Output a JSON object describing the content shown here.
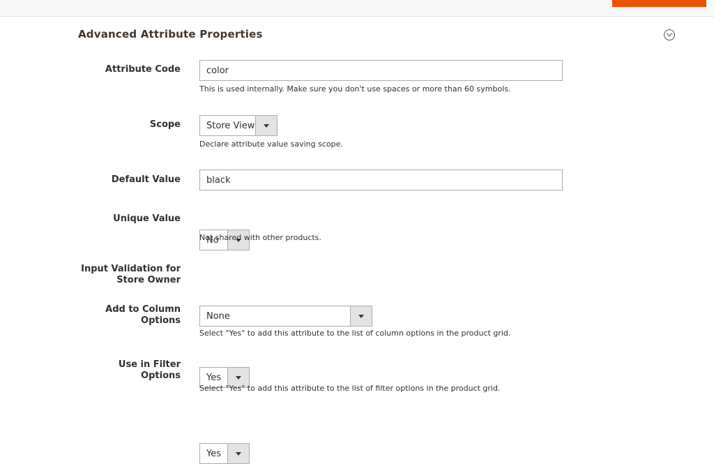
{
  "section": {
    "title": "Advanced Attribute Properties"
  },
  "fields": {
    "attribute_code": {
      "label": "Attribute Code",
      "value": "color",
      "note": "This is used internally. Make sure you don't use spaces or more than 60 symbols."
    },
    "scope": {
      "label": "Scope",
      "value": "Store View",
      "note": "Declare attribute value saving scope."
    },
    "default_value": {
      "label": "Default Value",
      "value": "black"
    },
    "unique_value": {
      "label": "Unique Value",
      "value": "No",
      "note": "Not shared with other products."
    },
    "input_validation": {
      "label_line1": "Input Validation for",
      "label_line2": "Store Owner",
      "value": "None"
    },
    "add_to_column": {
      "label_line1": "Add to Column",
      "label_line2": "Options",
      "value": "Yes",
      "note": "Select \"Yes\" to add this attribute to the list of column options in the product grid."
    },
    "use_in_filter": {
      "label_line1": "Use in Filter",
      "label_line2": "Options",
      "value": "Yes",
      "note": "Select \"Yes\" to add this attribute to the list of filter options in the product grid."
    }
  },
  "colors": {
    "accent": "#eb5202",
    "border": "#adadad",
    "arrow_bg": "#e3e3e3"
  },
  "icons": {
    "collapse": "chevron-circle-up-icon",
    "dropdown": "triangle-down-icon"
  }
}
